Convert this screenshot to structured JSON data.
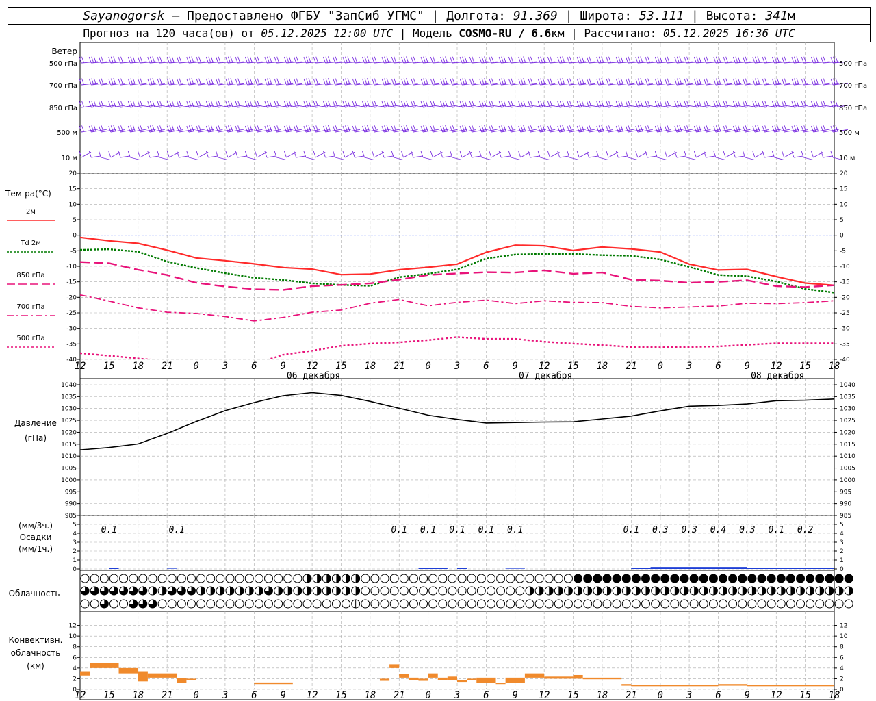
{
  "header": {
    "station": "Sayanogorsk",
    "provider": " — Предоставлено ФГБУ \"ЗапСиб УГМС\" | Долгота: ",
    "lon": "91.369",
    "lat_label": " | Широта: ",
    "lat": "53.111",
    "alt_label": " | Высота: ",
    "alt": "341",
    "alt_unit": "м",
    "forecast_prefix": "Прогноз на 120 часа(ов) от ",
    "forecast_start": "05.12.2025 12:00 UTC",
    "model_label": " | Модель ",
    "model": "COSMO-RU / 6.6",
    "model_unit": "км",
    "calc_label": " | Рассчитано: ",
    "calc_time": "05.12.2025 16:36 UTC"
  },
  "labels": {
    "wind": "Ветер",
    "wind_levels": [
      "500 гПа",
      "700 гПа",
      "850 гПа",
      "500 м",
      "10 м"
    ],
    "temp_title": "Тем-ра(°C)",
    "temp_legend": [
      {
        "text": "2м",
        "color": "#ff2a2a",
        "dash": ""
      },
      {
        "text": "Td 2м",
        "color": "#007a00",
        "dash": "3,2"
      },
      {
        "text": "850 гПа",
        "color": "#e8137a",
        "dash": "12,5"
      },
      {
        "text": "700 гПа",
        "color": "#e8137a",
        "dash": "10,4,3,4"
      },
      {
        "text": "500 гПа",
        "color": "#e8137a",
        "dash": "3,3"
      }
    ],
    "pressure_title": "Давление",
    "pressure_unit": "(гПа)",
    "precip_lines": [
      "(мм/3ч.)",
      "Осадки",
      "(мм/1ч.)"
    ],
    "cloud_title": "Облачность",
    "conv_lines": [
      "Конвективн.",
      "облачность",
      "(км)"
    ]
  },
  "colors": {
    "wind": "#7a2ee0",
    "pressure": "#000000",
    "precip": "#1f3fd6",
    "conv": "#f08a2c",
    "zero_line": "#3355ff"
  },
  "chart_data": [
    {
      "type": "line",
      "title": "Тем-ра(°C)",
      "x_ticks": [
        "12",
        "15",
        "18",
        "21",
        "0",
        "3",
        "6",
        "9",
        "12",
        "15",
        "18",
        "21",
        "0",
        "3",
        "6",
        "9",
        "12",
        "15",
        "18",
        "21",
        "0",
        "3",
        "6",
        "9",
        "12",
        "15",
        "18"
      ],
      "date_labels": [
        "06 декабря",
        "07 декабря",
        "08 декабря"
      ],
      "ylim": [
        -40,
        20
      ],
      "y_ticks": [
        20,
        15,
        10,
        5,
        0,
        -5,
        -10,
        -15,
        -20,
        -25,
        -30,
        -35,
        -40
      ],
      "series": [
        {
          "name": "2м",
          "values": [
            -0.7,
            -1.8,
            -2.6,
            -4.8,
            -7.3,
            -8.2,
            -9.2,
            -10.4,
            -10.9,
            -12.7,
            -12.5,
            -11.1,
            -10.3,
            -9.3,
            -5.5,
            -3.2,
            -3.4,
            -4.9,
            -3.8,
            -4.4,
            -5.4,
            -9.3,
            -11.2,
            -11.0,
            -13.3,
            -15.4,
            -16.1
          ]
        },
        {
          "name": "Td 2м",
          "values": [
            -4.7,
            -4.5,
            -5.3,
            -8.5,
            -10.5,
            -12.2,
            -13.7,
            -14.4,
            -15.5,
            -16.0,
            -16.3,
            -13.5,
            -12.4,
            -11.0,
            -7.5,
            -6.2,
            -6.0,
            -6.0,
            -6.4,
            -6.6,
            -7.8,
            -10.2,
            -12.8,
            -13.2,
            -14.9,
            -17.3,
            -18.5
          ]
        },
        {
          "name": "850 гПа",
          "values": [
            -8.6,
            -9.0,
            -11.1,
            -12.8,
            -15.3,
            -16.5,
            -17.4,
            -17.6,
            -16.4,
            -16.0,
            -15.5,
            -14.3,
            -12.8,
            -12.3,
            -11.9,
            -12.0,
            -11.3,
            -12.4,
            -12.0,
            -14.3,
            -14.6,
            -15.3,
            -15.0,
            -14.5,
            -16.4,
            -16.7,
            -16.1
          ]
        },
        {
          "name": "700 гПа",
          "values": [
            -19.2,
            -21.2,
            -23.4,
            -24.8,
            -25.2,
            -26.2,
            -27.6,
            -26.5,
            -24.8,
            -24.1,
            -21.9,
            -20.7,
            -22.7,
            -21.6,
            -20.9,
            -22.0,
            -21.1,
            -21.6,
            -21.7,
            -22.9,
            -23.4,
            -23.1,
            -22.8,
            -21.9,
            -22.0,
            -21.7,
            -21.1
          ]
        },
        {
          "name": "500 гПа",
          "values": [
            -38.0,
            -38.8,
            -39.7,
            -40.5,
            -43.0,
            -42.5,
            -41.5,
            -38.5,
            -37.2,
            -35.6,
            -34.9,
            -34.5,
            -33.8,
            -32.8,
            -33.4,
            -33.4,
            -34.3,
            -34.9,
            -35.4,
            -36.0,
            -36.1,
            -36.0,
            -35.8,
            -35.3,
            -34.8,
            -34.8,
            -34.8
          ]
        }
      ]
    },
    {
      "type": "line",
      "title": "Давление",
      "ylabel": "(гПа)",
      "ylim": [
        985,
        1040
      ],
      "y_ticks": [
        1040,
        1035,
        1030,
        1025,
        1020,
        1015,
        1010,
        1005,
        1000,
        995,
        990,
        985
      ],
      "series": [
        {
          "name": "Давление",
          "values": [
            1012.6,
            1013.6,
            1015.1,
            1019.5,
            1024.5,
            1029.1,
            1032.5,
            1035.4,
            1036.7,
            1035.5,
            1033.0,
            1030.1,
            1027.2,
            1025.4,
            1023.9,
            1024.1,
            1024.3,
            1024.4,
            1025.6,
            1026.8,
            1029.0,
            1031.0,
            1031.3,
            1031.9,
            1033.3,
            1033.5,
            1034.0
          ]
        }
      ]
    },
    {
      "type": "bar",
      "title": "Осадки",
      "ylim": [
        0,
        5
      ],
      "y_ticks": [
        5,
        4,
        3,
        2,
        1,
        0
      ],
      "labels": [
        {
          "x": 3,
          "text": "0.1"
        },
        {
          "x": 10,
          "text": "0.1"
        },
        {
          "x": 33,
          "text": "0.1"
        },
        {
          "x": 36,
          "text": "0.1"
        },
        {
          "x": 39,
          "text": "0.1"
        },
        {
          "x": 42,
          "text": "0.1"
        },
        {
          "x": 45,
          "text": "0.1"
        },
        {
          "x": 57,
          "text": "0.1"
        },
        {
          "x": 60,
          "text": "0.3"
        },
        {
          "x": 63,
          "text": "0.3"
        },
        {
          "x": 66,
          "text": "0.4"
        },
        {
          "x": 69,
          "text": "0.3"
        },
        {
          "x": 72,
          "text": "0.1"
        },
        {
          "x": 75,
          "text": "0.2"
        }
      ],
      "bars": [
        {
          "x0": 3,
          "x1": 4,
          "v": 0.1
        },
        {
          "x0": 9,
          "x1": 10,
          "v": 0.05
        },
        {
          "x0": 35,
          "x1": 38,
          "v": 0.12
        },
        {
          "x0": 39,
          "x1": 40,
          "v": 0.1
        },
        {
          "x0": 44,
          "x1": 46,
          "v": 0.05
        },
        {
          "x0": 57,
          "x1": 59,
          "v": 0.15
        },
        {
          "x0": 59,
          "x1": 69,
          "v": 0.22
        },
        {
          "x0": 69,
          "x1": 78,
          "v": 0.15
        }
      ]
    },
    {
      "type": "bar",
      "title": "Конвективн. облачность",
      "ylabel": "(км)",
      "ylim": [
        0,
        14
      ],
      "y_ticks": [
        12,
        10,
        8,
        6,
        4,
        2,
        0
      ],
      "bars": [
        {
          "x0": 0,
          "x1": 1,
          "y0": 2.6,
          "y1": 3.4
        },
        {
          "x0": 1,
          "x1": 4,
          "y0": 4.0,
          "y1": 5.0
        },
        {
          "x0": 4,
          "x1": 6,
          "y0": 3.0,
          "y1": 4.0
        },
        {
          "x0": 6,
          "x1": 7,
          "y0": 1.5,
          "y1": 3.4
        },
        {
          "x0": 7,
          "x1": 10,
          "y0": 2.2,
          "y1": 3.0
        },
        {
          "x0": 10,
          "x1": 11,
          "y0": 1.2,
          "y1": 2.1
        },
        {
          "x0": 11,
          "x1": 12,
          "y0": 1.7,
          "y1": 2.0
        },
        {
          "x0": 18,
          "x1": 22,
          "y0": 1.0,
          "y1": 1.3
        },
        {
          "x0": 31,
          "x1": 32,
          "y0": 1.6,
          "y1": 2.0
        },
        {
          "x0": 32,
          "x1": 33,
          "y0": 4.0,
          "y1": 4.7
        },
        {
          "x0": 33,
          "x1": 34,
          "y0": 2.2,
          "y1": 2.9
        },
        {
          "x0": 34,
          "x1": 35,
          "y0": 1.8,
          "y1": 2.2
        },
        {
          "x0": 35,
          "x1": 36,
          "y0": 1.6,
          "y1": 2.0
        },
        {
          "x0": 36,
          "x1": 37,
          "y0": 2.2,
          "y1": 3.0
        },
        {
          "x0": 37,
          "x1": 38,
          "y0": 1.7,
          "y1": 2.2
        },
        {
          "x0": 38,
          "x1": 39,
          "y0": 1.8,
          "y1": 2.4
        },
        {
          "x0": 39,
          "x1": 40,
          "y0": 1.4,
          "y1": 1.8
        },
        {
          "x0": 40,
          "x1": 41,
          "y0": 1.8,
          "y1": 2.0
        },
        {
          "x0": 41,
          "x1": 43,
          "y0": 1.2,
          "y1": 2.2
        },
        {
          "x0": 43,
          "x1": 44,
          "y0": 1.0,
          "y1": 1.2
        },
        {
          "x0": 44,
          "x1": 46,
          "y0": 1.2,
          "y1": 2.2
        },
        {
          "x0": 46,
          "x1": 48,
          "y0": 2.2,
          "y1": 3.0
        },
        {
          "x0": 48,
          "x1": 51,
          "y0": 2.0,
          "y1": 2.4
        },
        {
          "x0": 51,
          "x1": 52,
          "y0": 2.0,
          "y1": 2.7
        },
        {
          "x0": 52,
          "x1": 56,
          "y0": 1.9,
          "y1": 2.2
        },
        {
          "x0": 56,
          "x1": 57,
          "y0": 0.7,
          "y1": 1.0
        },
        {
          "x0": 57,
          "x1": 63,
          "y0": 0.6,
          "y1": 0.8
        },
        {
          "x0": 63,
          "x1": 66,
          "y0": 0.6,
          "y1": 0.8
        },
        {
          "x0": 66,
          "x1": 69,
          "y0": 0.7,
          "y1": 1.0
        },
        {
          "x0": 69,
          "x1": 78,
          "y0": 0.6,
          "y1": 0.8
        }
      ]
    }
  ],
  "clouds": {
    "rows": [
      "00000000000000000000000222222000000000000000000000044444444444444444444444444444",
      "33333332233322222223222222222000000000000000002222222222222222222222222222222222",
      "00300333000000000000000000001000000000000000000000000000000000000000000000000000"
    ]
  }
}
